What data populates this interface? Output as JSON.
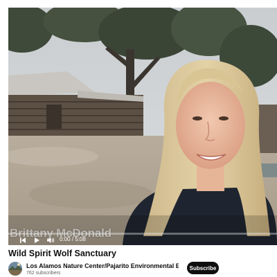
{
  "video": {
    "caption_overlay": "Brittany McDonald",
    "time_display": "0:00 / 5:08",
    "progress": 0.0,
    "accent_color": "#ff0000",
    "controls": {
      "previous": "skip-previous-icon",
      "play": "play-icon",
      "volume": "volume-icon"
    }
  },
  "meta": {
    "title": "Wild Spirit Wolf Sanctuary",
    "channel_name": "Los Alamos Nature Center/Pajarito Environmental Education C...",
    "subscribers": "762 subscribers",
    "subscribe_label": "Subscribe"
  }
}
